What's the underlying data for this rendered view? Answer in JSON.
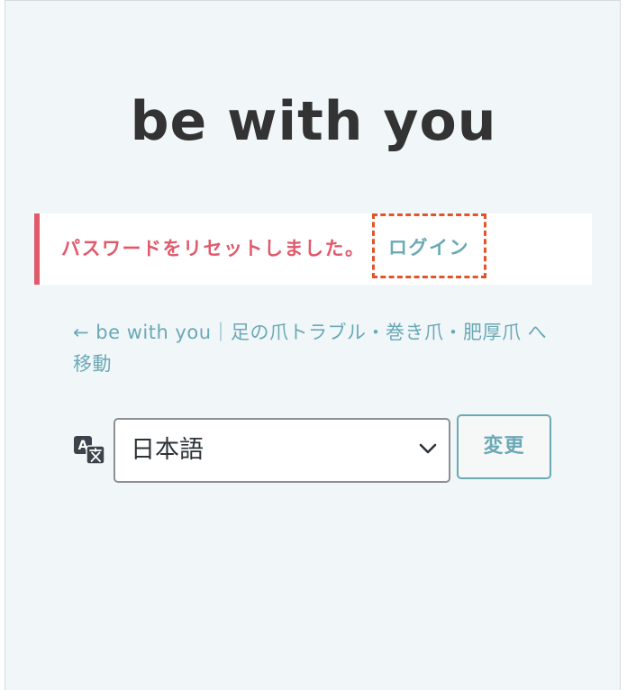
{
  "brand": {
    "title": "be with you"
  },
  "notice": {
    "message": "パスワードをリセットしました。",
    "login_link": "ログイン"
  },
  "back_link": {
    "text": "← be with you｜足の爪トラブル・巻き爪・肥厚爪 へ移動"
  },
  "language": {
    "icon": "translation-icon",
    "selected": "日本語",
    "change_label": "変更"
  },
  "colors": {
    "background": "#f1f6f9",
    "error_accent": "#e05a6c",
    "link": "#6aa9b5",
    "highlight_dashed": "#e4542a"
  }
}
